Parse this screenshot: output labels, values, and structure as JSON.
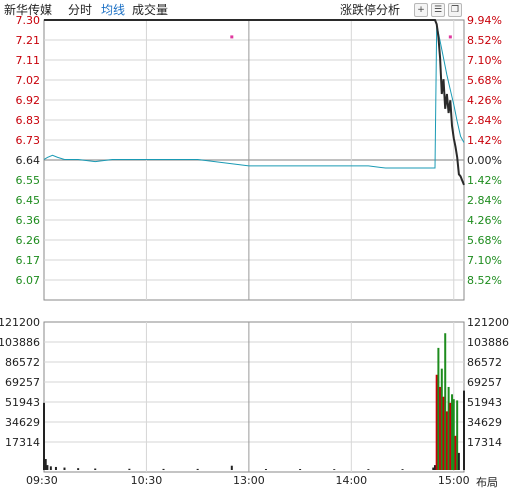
{
  "toolbar": {
    "title": "新华传媒",
    "tab_fenshi": "分时",
    "tab_junxian": "均线",
    "tab_volume": "成交量",
    "analysis": "涨跌停分析",
    "btn_plus": "+",
    "btn_menu": "☰",
    "btn_restore": "❐"
  },
  "footer_label": "布局",
  "colors": {
    "up": "#c8000a",
    "down": "#1e8c1e",
    "price_line": "#2a2a2a",
    "avg_line": "#1a9ab4",
    "limit_line": "#1a5cb8",
    "grid": "#d6d6d6",
    "marker": "#e0389e"
  },
  "chart_data": {
    "type": "line",
    "title": "",
    "price": {
      "prev_close": 6.64,
      "left_ticks": [
        "7.30",
        "7.21",
        "7.11",
        "7.02",
        "6.92",
        "6.83",
        "6.73",
        "6.64",
        "6.55",
        "6.45",
        "6.36",
        "6.26",
        "6.17",
        "6.07"
      ],
      "right_ticks": [
        "9.94%",
        "8.52%",
        "7.10%",
        "5.68%",
        "4.26%",
        "2.84%",
        "1.42%",
        "0.00%",
        "1.42%",
        "2.84%",
        "4.26%",
        "5.68%",
        "7.10%",
        "8.52%"
      ],
      "ylim": [
        6.07,
        7.3
      ],
      "series": [
        {
          "kind": "price",
          "points": [
            [
              0,
              7.3
            ],
            [
              229,
              7.3
            ],
            [
              230,
              7.28
            ],
            [
              231,
              7.22
            ],
            [
              232,
              7.12
            ],
            [
              233,
              6.95
            ],
            [
              234,
              7.02
            ],
            [
              235,
              6.88
            ],
            [
              236,
              6.95
            ],
            [
              237,
              6.86
            ],
            [
              238,
              6.92
            ],
            [
              239,
              6.8
            ],
            [
              240,
              6.74
            ],
            [
              241,
              6.7
            ],
            [
              242,
              6.65
            ],
            [
              243,
              6.57
            ],
            [
              244,
              6.56
            ],
            [
              245,
              6.54
            ],
            [
              246,
              6.52
            ]
          ]
        },
        {
          "kind": "average",
          "points": [
            [
              0,
              6.64
            ],
            [
              2,
              6.65
            ],
            [
              5,
              6.66
            ],
            [
              8,
              6.65
            ],
            [
              12,
              6.64
            ],
            [
              20,
              6.64
            ],
            [
              30,
              6.63
            ],
            [
              40,
              6.64
            ],
            [
              50,
              6.64
            ],
            [
              60,
              6.64
            ],
            [
              70,
              6.64
            ],
            [
              80,
              6.64
            ],
            [
              90,
              6.64
            ],
            [
              100,
              6.63
            ],
            [
              110,
              6.62
            ],
            [
              120,
              6.61
            ],
            [
              130,
              6.61
            ],
            [
              140,
              6.61
            ],
            [
              150,
              6.61
            ],
            [
              160,
              6.61
            ],
            [
              170,
              6.61
            ],
            [
              180,
              6.61
            ],
            [
              190,
              6.61
            ],
            [
              200,
              6.6
            ],
            [
              210,
              6.6
            ],
            [
              220,
              6.6
            ],
            [
              229,
              6.6
            ],
            [
              230,
              7.28
            ],
            [
              232,
              7.2
            ],
            [
              234,
              7.12
            ],
            [
              236,
              7.04
            ],
            [
              238,
              6.97
            ],
            [
              240,
              6.9
            ],
            [
              242,
              6.82
            ],
            [
              244,
              6.75
            ],
            [
              246,
              6.72
            ]
          ]
        }
      ],
      "limit_up": 7.3,
      "markers": [
        {
          "t": 110,
          "v": 7.22
        },
        {
          "t": 238,
          "v": 7.22
        }
      ]
    },
    "volume": {
      "ticks": [
        "121200",
        "103886",
        "86572",
        "69257",
        "51943",
        "34629",
        "17314"
      ],
      "ylim": [
        0,
        121200
      ],
      "bars": [
        {
          "t": 0,
          "v": 55000,
          "c": "neutral"
        },
        {
          "t": 1,
          "v": 9000,
          "c": "neutral"
        },
        {
          "t": 2,
          "v": 4000,
          "c": "neutral"
        },
        {
          "t": 4,
          "v": 3000,
          "c": "neutral"
        },
        {
          "t": 7,
          "v": 2500,
          "c": "neutral"
        },
        {
          "t": 12,
          "v": 2000,
          "c": "neutral"
        },
        {
          "t": 20,
          "v": 1500,
          "c": "neutral"
        },
        {
          "t": 30,
          "v": 1200,
          "c": "neutral"
        },
        {
          "t": 50,
          "v": 1000,
          "c": "neutral"
        },
        {
          "t": 70,
          "v": 900,
          "c": "neutral"
        },
        {
          "t": 90,
          "v": 900,
          "c": "neutral"
        },
        {
          "t": 110,
          "v": 3500,
          "c": "neutral"
        },
        {
          "t": 130,
          "v": 800,
          "c": "neutral"
        },
        {
          "t": 150,
          "v": 800,
          "c": "neutral"
        },
        {
          "t": 170,
          "v": 700,
          "c": "neutral"
        },
        {
          "t": 190,
          "v": 700,
          "c": "neutral"
        },
        {
          "t": 210,
          "v": 700,
          "c": "neutral"
        },
        {
          "t": 228,
          "v": 2000,
          "c": "neutral"
        },
        {
          "t": 229,
          "v": 4000,
          "c": "neutral"
        },
        {
          "t": 230,
          "v": 78000,
          "c": "up"
        },
        {
          "t": 231,
          "v": 100000,
          "c": "down"
        },
        {
          "t": 232,
          "v": 68000,
          "c": "up"
        },
        {
          "t": 233,
          "v": 83000,
          "c": "down"
        },
        {
          "t": 234,
          "v": 60000,
          "c": "up"
        },
        {
          "t": 235,
          "v": 112000,
          "c": "down"
        },
        {
          "t": 236,
          "v": 48000,
          "c": "up"
        },
        {
          "t": 237,
          "v": 68000,
          "c": "down"
        },
        {
          "t": 238,
          "v": 55000,
          "c": "up"
        },
        {
          "t": 239,
          "v": 62000,
          "c": "down"
        },
        {
          "t": 240,
          "v": 58000,
          "c": "down"
        },
        {
          "t": 241,
          "v": 28000,
          "c": "up"
        },
        {
          "t": 242,
          "v": 57000,
          "c": "down"
        },
        {
          "t": 243,
          "v": 14000,
          "c": "neutral"
        },
        {
          "t": 246,
          "v": 65000,
          "c": "neutral"
        }
      ]
    },
    "x_ticks": [
      {
        "t": 0,
        "label": "09:30"
      },
      {
        "t": 60,
        "label": "10:30"
      },
      {
        "t": 120,
        "label": "13:00"
      },
      {
        "t": 180,
        "label": "14:00"
      },
      {
        "t": 240,
        "label": "15:00"
      }
    ],
    "xlim": [
      0,
      246
    ]
  }
}
